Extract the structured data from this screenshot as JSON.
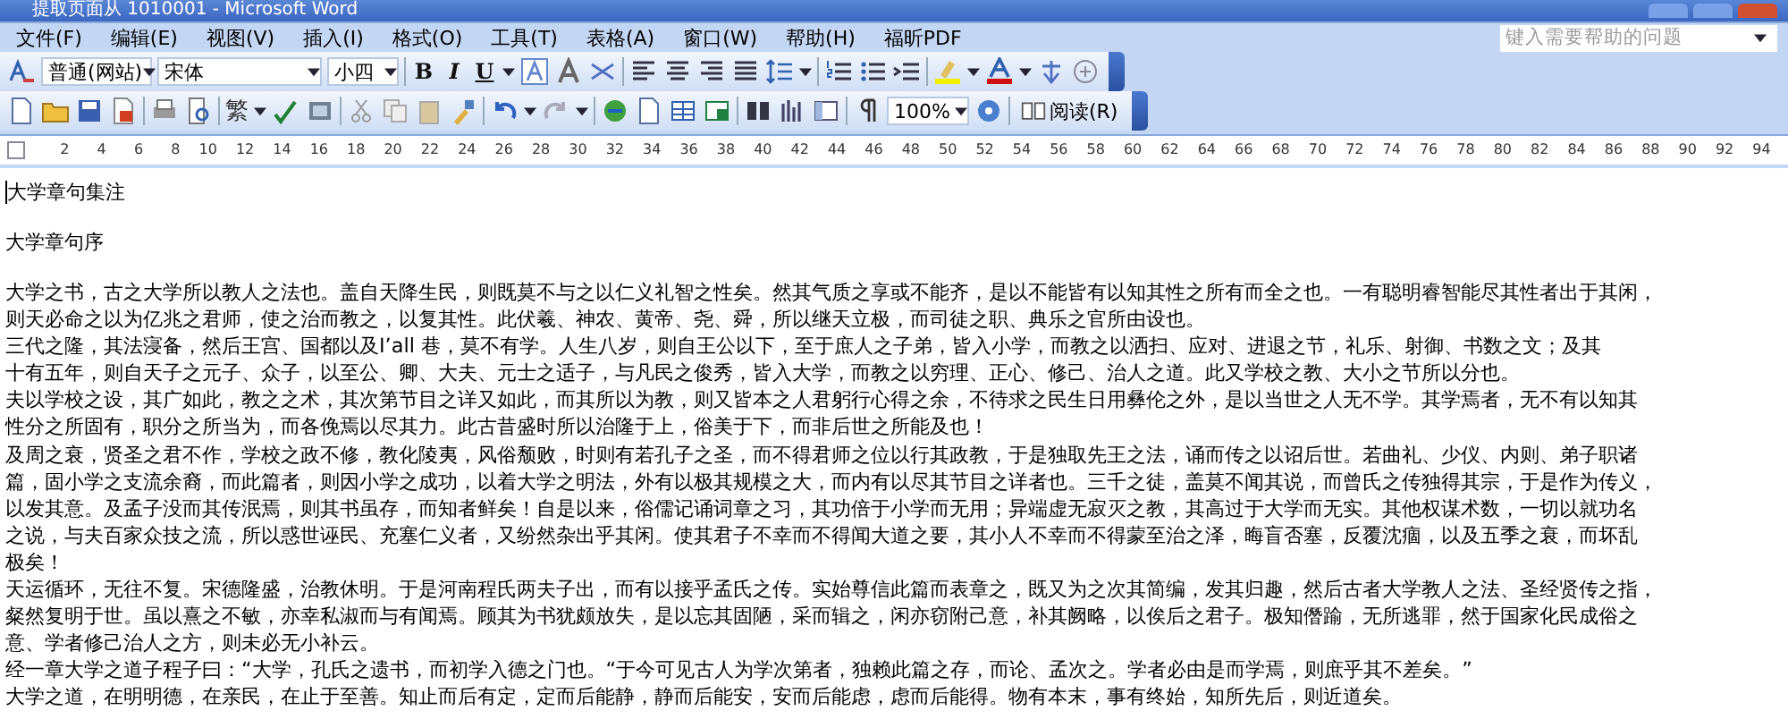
{
  "window": {
    "title": "提取页面从 1010001 - Microsoft Word"
  },
  "menu": [
    "文件(F)",
    "编辑(E)",
    "视图(V)",
    "插入(I)",
    "格式(O)",
    "工具(T)",
    "表格(A)",
    "窗口(W)",
    "帮助(H)",
    "福昕PDF"
  ],
  "help_search": {
    "placeholder": "键入需要帮助的问题"
  },
  "formatting_toolbar": {
    "style": "普通(网站)",
    "font": "宋体",
    "size": "小四",
    "bold": "B",
    "italic": "I",
    "underline": "U"
  },
  "standard_toolbar": {
    "traditional": "繁",
    "zoom": "100%",
    "read_button": "阅读(R)"
  },
  "ruler": {
    "ticks": [
      "2",
      "4",
      "6",
      "8",
      "10",
      "12",
      "14",
      "16",
      "18",
      "20",
      "22",
      "24",
      "26",
      "28",
      "30",
      "32",
      "34",
      "36",
      "38",
      "40",
      "42",
      "44",
      "46",
      "48",
      "50",
      "52",
      "54",
      "56",
      "58",
      "60",
      "62",
      "64",
      "66",
      "68",
      "70",
      "72",
      "74",
      "76",
      "78",
      "80",
      "82",
      "84",
      "86",
      "88",
      "90",
      "92",
      "94"
    ]
  },
  "document": {
    "title": "大学章句集注",
    "subtitle": "大学章句序",
    "lines": [
      "大学之书，古之大学所以教人之法也。盖自天降生民，则既莫不与之以仁义礼智之性矣。然其气质之享或不能齐，是以不能皆有以知其性之所有而全之也。一有聪明睿智能尽其性者出于其闲，",
      "则天必命之以为亿兆之君师，使之治而教之，以复其性。此伏羲、神农、黄帝、尧、舜，所以继天立极，而司徒之职、典乐之官所由设也。",
      "三代之隆，其法寖备，然后王宫、国都以及I’all 巷，莫不有学。人生八岁，则自王公以下，至于庶人之子弟，皆入小学，而教之以洒扫、应对、进退之节，礼乐、射御、书数之文；及其",
      "十有五年，则自天子之元子、众子，以至公、卿、大夫、元士之适子，与凡民之俊秀，皆入大学，而教之以穷理、正心、修己、治人之道。此又学校之教、大小之节所以分也。",
      "夫以学校之设，其广如此，教之之术，其次第节目之详又如此，而其所以为教，则又皆本之人君躬行心得之余，不待求之民生日用彝伦之外，是以当世之人无不学。其学焉者，无不有以知其",
      "性分之所固有，职分之所当为，而各俛焉以尽其力。此古昔盛时所以治隆于上，俗美于下，而非后世之所能及也！",
      "及周之衰，贤圣之君不作，学校之政不修，教化陵夷，风俗颓败，时则有若孔子之圣，而不得君师之位以行其政教，于是独取先王之法，诵而传之以诏后世。若曲礼、少仪、内则、弟子职诸",
      "篇，固小学之支流余裔，而此篇者，则因小学之成功，以着大学之明法，外有以极其规模之大，而内有以尽其节目之详者也。三千之徒，盖莫不闻其说，而曾氏之传独得其宗，于是作为传义，",
      "以发其意。及孟子没而其传泯焉，则其书虽存，而知者鲜矣！自是以来，俗儒记诵词章之习，其功倍于小学而无用；异端虚无寂灭之教，其高过于大学而无实。其他权谋术数，一切以就功名",
      "之说，与夫百家众技之流，所以惑世诬民、充塞仁义者，又纷然杂出乎其闲。使其君子不幸而不得闻大道之要，其小人不幸而不得蒙至治之泽，晦盲否塞，反覆沈痼，以及五季之衰，而坏乱",
      "极矣！",
      "天运循环，无往不复。宋德隆盛，治教休明。于是河南程氏两夫子出，而有以接乎孟氏之传。实始尊信此篇而表章之，既又为之次其简编，发其归趣，然后古者大学教人之法、圣经贤传之指，",
      "粲然复明于世。虽以熹之不敏，亦幸私淑而与有闻焉。顾其为书犹颇放失，是以忘其固陋，采而辑之，闲亦窃附己意，补其阙略，以俟后之君子。极知僭踰，无所逃罪，然于国家化民成俗之",
      "意、学者修己治人之方，则未必无小补云。",
      "经一章大学之道子程子曰：“大学，孔氏之遗书，而初学入德之门也。“于今可见古人为学次第者，独赖此篇之存，而论、孟次之。学者必由是而学焉，则庶乎其不差矣。”",
      "大学之道，在明明德，在亲民，在止于至善。知止而后有定，定而后能静，静而后能安，安而后能虑，虑而后能得。物有本末，事有终始，知所先后，则近道矣。"
    ]
  }
}
